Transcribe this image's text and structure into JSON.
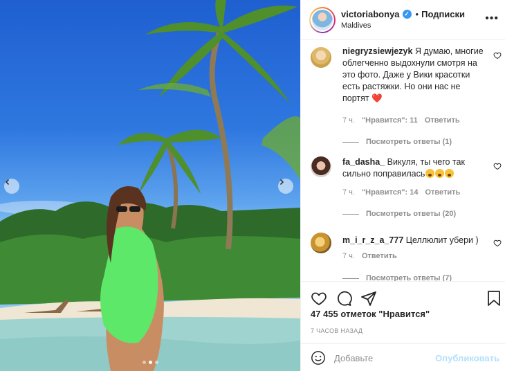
{
  "post": {
    "username": "victoriabonya",
    "separator": "•",
    "follow_label": "Подписки",
    "location": "Maldives",
    "more_label": "•••"
  },
  "comments": [
    {
      "username": "niegryzsiewjezyk",
      "text": "Я думаю, многие облегченно выдохнули смотря на это фото. Даже у Вики красотки есть растяжки. Но они нас не портят",
      "time": "7 ч.",
      "likes": "\"Нравится\": 11",
      "reply": "Ответить",
      "view_replies": "Посмотреть ответы (1)",
      "emoji": "❤️"
    },
    {
      "username": "fa_dasha_",
      "text": "Викуля, ты чего так сильно поправилась",
      "time": "7 ч.",
      "likes": "\"Нравится\": 14",
      "reply": "Ответить",
      "view_replies": "Посмотреть ответы (20)"
    },
    {
      "username": "m_i_r_z_a_777",
      "text": "Целлюлит убери )",
      "time": "7 ч.",
      "reply": "Ответить",
      "view_replies": "Посмотреть ответы (7)"
    }
  ],
  "stats": {
    "likes": "47 455 отметок \"Нравится\"",
    "posted": "7 ЧАСОВ НАЗАД"
  },
  "composer": {
    "placeholder": "Добавьте",
    "publish_label": "Опубликовать"
  },
  "icons": [
    "more-icon",
    "verified-icon",
    "heart-icon",
    "comment-icon",
    "share-icon",
    "bookmark-icon",
    "smile-icon",
    "chevron-left-icon",
    "chevron-right-icon"
  ],
  "colors": {
    "accent": "#3897f0",
    "publish_disabled": "#b2dffc",
    "muted": "#8e8e8e",
    "like_heart": "#ed1c24"
  }
}
